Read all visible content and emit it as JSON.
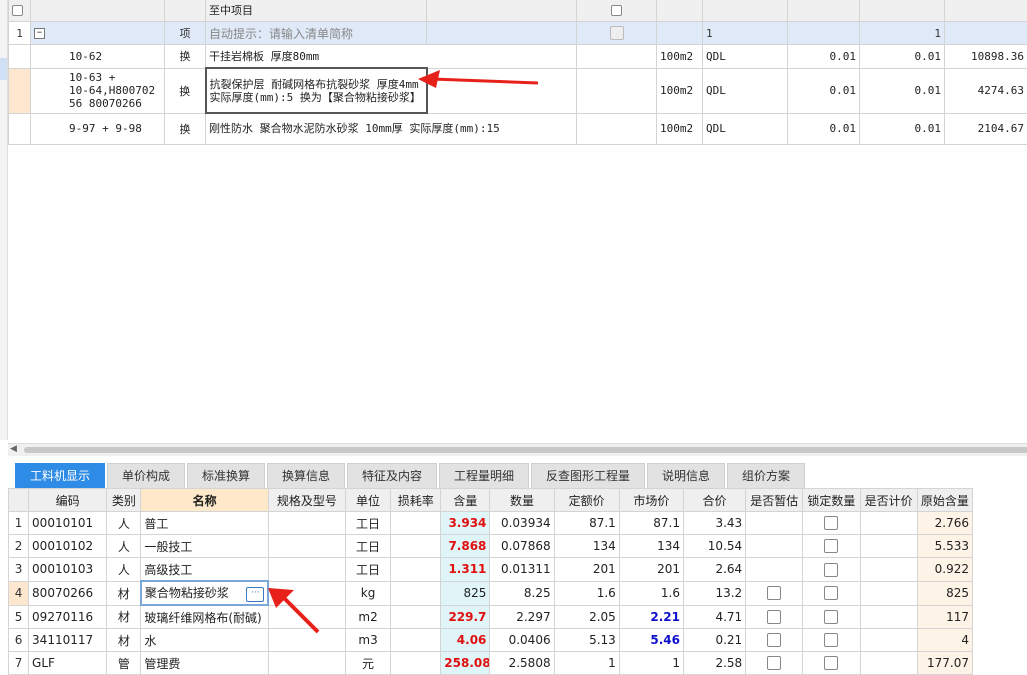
{
  "top_header_partial": "至中项目",
  "top_rows": [
    {
      "no": "1",
      "code": "",
      "type": "项",
      "name": "自动提示：请输入清单简称",
      "unit": "",
      "expr": "",
      "qty_expr": "1",
      "qty": "1",
      "price": ""
    },
    {
      "no": "",
      "code": "10-62",
      "type": "换",
      "name": "干挂岩棉板 厚度80mm",
      "unit": "100m2",
      "expr": "QDL",
      "qty_expr": "0.01",
      "qty": "0.01",
      "price": "10898.36"
    },
    {
      "no": "",
      "code": "10-63 +\n10-64,H800702\n56 80070266",
      "type": "换",
      "name": "抗裂保护层 耐碱网格布抗裂砂浆 厚度4mm  实际厚度(mm):5  换为【聚合物粘接砂浆】",
      "unit": "100m2",
      "expr": "QDL",
      "qty_expr": "0.01",
      "qty": "0.01",
      "price": "4274.63"
    },
    {
      "no": "",
      "code": "9-97 + 9-98",
      "type": "换",
      "name": "刚性防水 聚合物水泥防水砂浆 10mm厚 实际厚度(mm):15",
      "unit": "100m2",
      "expr": "QDL",
      "qty_expr": "0.01",
      "qty": "0.01",
      "price": "2104.67"
    }
  ],
  "tabs": [
    "工料机显示",
    "单价构成",
    "标准换算",
    "换算信息",
    "特征及内容",
    "工程量明细",
    "反查图形工程量",
    "说明信息",
    "组价方案"
  ],
  "columns": [
    "编码",
    "类别",
    "名称",
    "规格及型号",
    "单位",
    "损耗率",
    "含量",
    "数量",
    "定额价",
    "市场价",
    "合价",
    "是否暂估",
    "锁定数量",
    "是否计价",
    "原始含量"
  ],
  "rows": [
    {
      "no": "1",
      "code": "00010101",
      "cat": "人",
      "name": "普工",
      "spec": "",
      "unit": "工日",
      "loss": "",
      "content": "3.934",
      "qty": "0.03934",
      "quota": "87.1",
      "market": "87.1",
      "total": "3.43",
      "orig": "2.766"
    },
    {
      "no": "2",
      "code": "00010102",
      "cat": "人",
      "name": "一般技工",
      "spec": "",
      "unit": "工日",
      "loss": "",
      "content": "7.868",
      "qty": "0.07868",
      "quota": "134",
      "market": "134",
      "total": "10.54",
      "orig": "5.533"
    },
    {
      "no": "3",
      "code": "00010103",
      "cat": "人",
      "name": "高级技工",
      "spec": "",
      "unit": "工日",
      "loss": "",
      "content": "1.311",
      "qty": "0.01311",
      "quota": "201",
      "market": "201",
      "total": "2.64",
      "orig": "0.922"
    },
    {
      "no": "4",
      "code": "80070266",
      "cat": "材",
      "name": "聚合物粘接砂浆",
      "spec": "",
      "unit": "kg",
      "loss": "",
      "content": "825",
      "qty": "8.25",
      "quota": "1.6",
      "market": "1.6",
      "total": "13.2",
      "orig": "825"
    },
    {
      "no": "5",
      "code": "09270116",
      "cat": "材",
      "name": "玻璃纤维网格布(耐碱)",
      "spec": "",
      "unit": "m2",
      "loss": "",
      "content": "229.7",
      "qty": "2.297",
      "quota": "2.05",
      "market": "2.21",
      "total": "4.71",
      "orig": "117"
    },
    {
      "no": "6",
      "code": "34110117",
      "cat": "材",
      "name": "水",
      "spec": "",
      "unit": "m3",
      "loss": "",
      "content": "4.06",
      "qty": "0.0406",
      "quota": "5.13",
      "market": "5.46",
      "total": "0.21",
      "orig": "4"
    },
    {
      "no": "7",
      "code": "GLF",
      "cat": "管",
      "name": "管理费",
      "spec": "",
      "unit": "元",
      "loss": "",
      "content": "258.08",
      "qty": "2.5808",
      "quota": "1",
      "market": "1",
      "total": "2.58",
      "orig": "177.07"
    }
  ],
  "colors": {
    "accent": "#2e8be6",
    "red": "#e01010",
    "blue": "#1010cc",
    "arrow": "#e8201a"
  }
}
